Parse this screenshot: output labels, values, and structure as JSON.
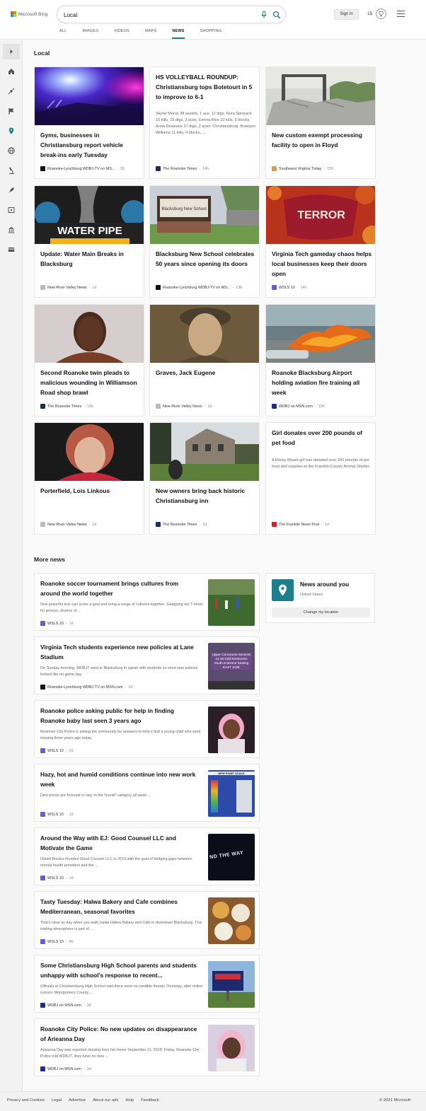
{
  "header": {
    "logo_text": "Microsoft Bing",
    "search_value": "Local",
    "signin_label": "Sign in",
    "rewards_count": "15",
    "tabs": [
      {
        "label": "ALL"
      },
      {
        "label": "IMAGES"
      },
      {
        "label": "VIDEOS"
      },
      {
        "label": "MAPS"
      },
      {
        "label": "NEWS"
      },
      {
        "label": "SHOPPING"
      }
    ],
    "active_tab": "NEWS",
    "accent_color": "#1b7f8c"
  },
  "sidebar": {
    "items": [
      "chevron-right-icon",
      "home-icon",
      "satellite-icon",
      "flag-icon",
      "location-icon",
      "globe-icon",
      "microscope-icon",
      "rocket-icon",
      "film-icon",
      "bank-icon",
      "card-icon"
    ]
  },
  "local": {
    "title": "Local",
    "cards": [
      {
        "title": "Gyms, businesses in Christiansburg report vehicle break-ins early Tuesday",
        "desc": "",
        "source": "Roanoke-Lynchburg WDBJ-TV on MS...",
        "time": "3h"
      },
      {
        "title": "HS VOLLEYBALL ROUNDUP: Christiansburg tops Botetourt in 5 to improve to 6-1",
        "desc": "Skylar Morris 38 assists, 1 ace, 11 digs, Nora Spickard 16 kills, 15 digs, 2 aces, Emma Rice 10 kills, 5 blocks, Anna Dewease 27 digs, 2 aces. Christiansburg: Braelynn Williams 11 kills, 4 blocks, ...",
        "source": "The Roanoke Times",
        "time": "14h"
      },
      {
        "title": "New custom exempt processing facility to open in Floyd",
        "desc": "",
        "source": "Southwest Virginia Today",
        "time": "22h"
      },
      {
        "title": "Update: Water Main Breaks in Blacksburg",
        "desc": "",
        "source": "New River Valley News",
        "time": "1d",
        "img_text": "WATER PIPE"
      },
      {
        "title": "Blacksburg New School celebrates 50 years since opening its doors",
        "desc": "",
        "source": "Roanoke-Lynchburg WDBJ-TV on MS...",
        "time": "13h",
        "img_text": "Blacksburg New School"
      },
      {
        "title": "Virginia Tech gameday chaos helps local businesses keep their doors open",
        "desc": "",
        "source": "WSLS 10",
        "time": "14h",
        "img_text": "TERROR"
      },
      {
        "title": "Second Roanoke twin pleads to malicious wounding in Williamson Road shop brawl",
        "desc": "",
        "source": "The Roanoke Times",
        "time": "19h"
      },
      {
        "title": "Graves, Jack Eugene",
        "desc": "",
        "source": "New River Valley News",
        "time": "1d"
      },
      {
        "title": "Roanoke Blacksburg Airport holding aviation fire training all week",
        "desc": "",
        "source": "WDBJ on MSN.com",
        "time": "19h"
      },
      {
        "title": "Porterfield, Lois Linkous",
        "desc": "",
        "source": "New River Valley News",
        "time": "1d"
      },
      {
        "title": "New owners bring back historic Christiansburg inn",
        "desc": "",
        "source": "The Roanoke Times",
        "time": "1d"
      },
      {
        "title": "Girl donates over 200 pounds of pet food",
        "desc": "A Rocky Mount girl has donated over 200 pounds of pet food and supplies to the Franklin County Animal Shelter.",
        "source": "The Franklin News Post",
        "time": "1d"
      }
    ]
  },
  "more_news": {
    "title": "More news",
    "items": [
      {
        "title": "Roanoke soccer tournament brings cultures from around the world together",
        "desc": "One powerful kick can score a goal and bring a range of cultures together. Swapping out T-shirts for jerseys, dozens of ...",
        "source": "WSLS 10",
        "time": "1d"
      },
      {
        "title": "Virginia Tech students experience new policies at Lane Stadium",
        "desc": "On Sunday morning, WDBJ7 went to Blacksburg to speak with students on what new policies looked like on game day.",
        "source": "Roanoke-Lynchburg WDBJ-TV on MSN.com",
        "time": "1d",
        "thumb_text": "Upper Concourse Sections 21-38 Odd Restrooms South Endzone Seating EAST SIDE"
      },
      {
        "title": "Roanoke police asking public for help in finding Roanoke baby last seen 3 years ago",
        "desc": "Roanoke City Police is asking the community for answers to help it find a young child who went missing three years ago today.",
        "source": "WSLS 10",
        "time": "2d"
      },
      {
        "title": "Hazy, hot and humid conditions continue into new work week",
        "desc": "Dew points are forecast to stay in the 'humid' category all week ...",
        "source": "WSLS 10",
        "time": "1d",
        "thumb_text": "DEW POINT SCALE"
      },
      {
        "title": "Around the Way with EJ: Good Counsel LLC and Motivate the Game",
        "desc": "Daniel Brooks founded Good Counsel LLC in 2019 with the goal of bridging gaps between mental health providers and the ...",
        "source": "WSLS 10",
        "time": "1d",
        "thumb_text": "ND THE WAY"
      },
      {
        "title": "Tasty Tuesday: Halwa Bakery and Cafe combines Mediterranean, seasonal favorites",
        "desc": "That's clear as day when you walk inside Halwa Bakery and Cafe in downtown Blacksburg. This inviting atmosphere is part of ...",
        "source": "WSLS 10",
        "time": "4h"
      },
      {
        "title": "Some Christiansburg High School parents and students unhappy with school's response to recent...",
        "desc": "Officials at Christiansburg High School said there were no credible threats Thursday, after online rumors. Montgomery County ...",
        "source": "WDBJ on MSN.com",
        "time": "3d"
      },
      {
        "title": "Roanoke City Police: No new updates on disappearance of Arieanna Day",
        "desc": "Arieanna Day was reported missing from her home September 11, 2018. Friday, Roanoke City Police told WDBJ7, they have no new ...",
        "source": "WDBJ on MSN.com",
        "time": "3d"
      }
    ]
  },
  "location": {
    "title": "News around you",
    "subtitle": "United States",
    "button": "Change my location"
  },
  "footer": {
    "links": [
      "Privacy and Cookies",
      "Legal",
      "Advertise",
      "About our ads",
      "Help",
      "Feedback"
    ],
    "copyright": "© 2021 Microsoft"
  }
}
